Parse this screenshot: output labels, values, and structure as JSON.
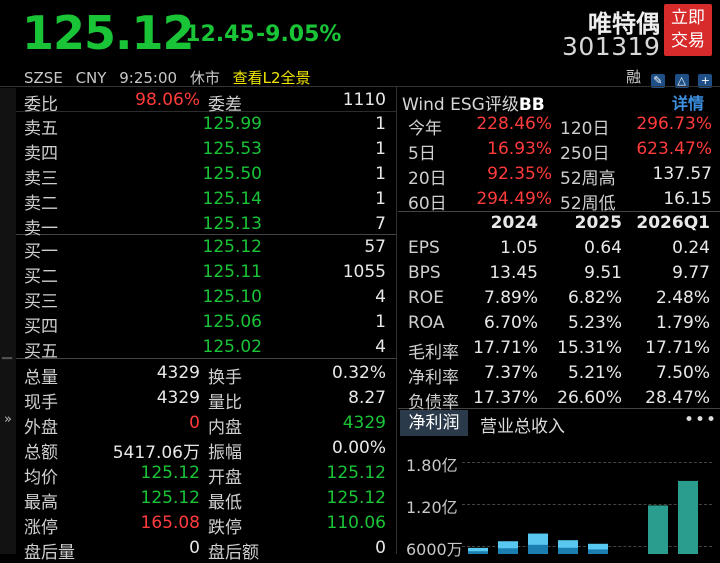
{
  "header": {
    "price": "125.12",
    "change": "-12.45",
    "change_pct": "-9.05%",
    "stock_name": "唯特偶",
    "stock_code": "301319",
    "trade_button": [
      "立即",
      "交易"
    ],
    "exchange": "SZSE",
    "currency": "CNY",
    "time": "9:25:00",
    "market_status": "休市",
    "l2_link": "查看L2全景",
    "margin_label": "融"
  },
  "left": {
    "weibi_label": "委比",
    "weibi_value": "98.06%",
    "weicha_label": "委差",
    "weicha_value": "1110",
    "asks": [
      {
        "label": "卖五",
        "price": "125.99",
        "vol": "1"
      },
      {
        "label": "卖四",
        "price": "125.53",
        "vol": "1"
      },
      {
        "label": "卖三",
        "price": "125.50",
        "vol": "1"
      },
      {
        "label": "卖二",
        "price": "125.14",
        "vol": "1"
      },
      {
        "label": "卖一",
        "price": "125.13",
        "vol": "7"
      }
    ],
    "bids": [
      {
        "label": "买一",
        "price": "125.12",
        "vol": "57"
      },
      {
        "label": "买二",
        "price": "125.11",
        "vol": "1055"
      },
      {
        "label": "买三",
        "price": "125.10",
        "vol": "4"
      },
      {
        "label": "买四",
        "price": "125.06",
        "vol": "1"
      },
      {
        "label": "买五",
        "price": "125.02",
        "vol": "4"
      }
    ],
    "stats": [
      {
        "l1": "总量",
        "v1": "4329",
        "c1": "white",
        "l2": "换手",
        "v2": "0.32%",
        "c2": "white"
      },
      {
        "l1": "现手",
        "v1": "4329",
        "c1": "white",
        "l2": "量比",
        "v2": "8.27",
        "c2": "white"
      },
      {
        "l1": "外盘",
        "v1": "0",
        "c1": "red",
        "l2": "内盘",
        "v2": "4329",
        "c2": "green"
      },
      {
        "l1": "总额",
        "v1": "5417.06万",
        "c1": "white",
        "l2": "振幅",
        "v2": "0.00%",
        "c2": "white"
      },
      {
        "l1": "均价",
        "v1": "125.12",
        "c1": "green",
        "l2": "开盘",
        "v2": "125.12",
        "c2": "green"
      },
      {
        "l1": "最高",
        "v1": "125.12",
        "c1": "green",
        "l2": "最低",
        "v2": "125.12",
        "c2": "green"
      },
      {
        "l1": "涨停",
        "v1": "165.08",
        "c1": "red",
        "l2": "跌停",
        "v2": "110.06",
        "c2": "green"
      },
      {
        "l1": "盘后量",
        "v1": "0",
        "c1": "white",
        "l2": "盘后额",
        "v2": "0",
        "c2": "white"
      }
    ]
  },
  "right": {
    "esg_title": "Wind ESG评级",
    "esg_rating": "BB",
    "detail_link": "详情",
    "perf": [
      {
        "l1": "今年",
        "a1": "228.46%",
        "c1": "red",
        "l2": "120日",
        "a2": "296.73%",
        "c2": "red"
      },
      {
        "l1": "5日",
        "a1": "16.93%",
        "c1": "red",
        "l2": "250日",
        "a2": "623.47%",
        "c2": "red"
      },
      {
        "l1": "20日",
        "a1": "92.35%",
        "c1": "red",
        "l2": "52周高",
        "a2": "137.57",
        "c2": "white"
      },
      {
        "l1": "60日",
        "a1": "294.49%",
        "c1": "red",
        "l2": "52周低",
        "a2": "16.15",
        "c2": "white"
      }
    ],
    "fin_headers": [
      "2024",
      "2025",
      "2026Q1"
    ],
    "fin_rows": [
      {
        "label": "EPS",
        "vals": [
          "1.05",
          "0.64",
          "0.24"
        ]
      },
      {
        "label": "BPS",
        "vals": [
          "13.45",
          "9.51",
          "9.77"
        ]
      },
      {
        "label": "ROE",
        "vals": [
          "7.89%",
          "6.82%",
          "2.48%"
        ]
      },
      {
        "label": "ROA",
        "vals": [
          "6.70%",
          "5.23%",
          "1.79%"
        ]
      },
      {
        "label": "毛利率",
        "vals": [
          "17.71%",
          "15.31%",
          "17.71%"
        ]
      },
      {
        "label": "净利率",
        "vals": [
          "7.37%",
          "5.21%",
          "7.50%"
        ]
      },
      {
        "label": "负债率",
        "vals": [
          "17.37%",
          "26.60%",
          "28.47%"
        ]
      }
    ],
    "tabs": [
      "净利润",
      "营业总收入"
    ],
    "more": "•••",
    "y_labels": [
      "1.80亿",
      "1.20亿",
      "6000万"
    ]
  },
  "chart_data": {
    "type": "bar",
    "title": "",
    "ylim": [
      0,
      180000000
    ],
    "series": [
      {
        "name": "",
        "values": [
          12000000,
          25000000,
          40000000,
          27000000,
          20000000,
          0,
          95000000,
          143000000
        ]
      }
    ],
    "colors": {
      "light": "#59c8f0",
      "dark": "#1a7fb0",
      "teal": "#2a9d8f"
    }
  }
}
